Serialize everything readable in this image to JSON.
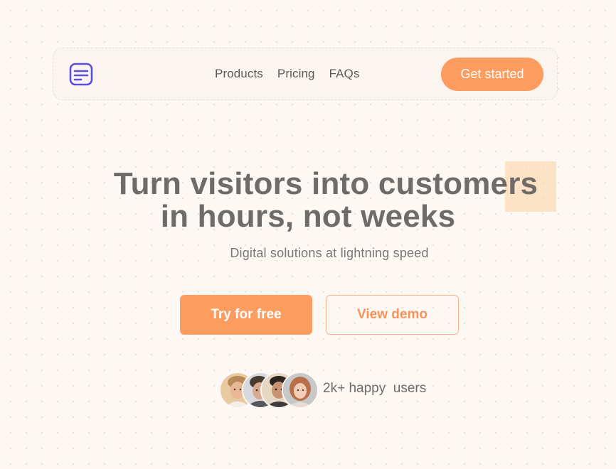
{
  "brand": {
    "logo_icon": "message-lines-icon",
    "accent_color": "#5b4fe0"
  },
  "nav": {
    "links": [
      "Products",
      "Pricing",
      "FAQs"
    ],
    "cta_label": "Get started"
  },
  "hero": {
    "title_line1": "Turn visitors into customers",
    "title_line2": "in hours, not weeks",
    "subtitle": "Digital solutions at lightning speed",
    "primary_cta": "Try for free",
    "secondary_cta": "View demo"
  },
  "social_proof": {
    "text": "2k+ happy  users",
    "avatars": [
      "user-avatar-1",
      "user-avatar-2",
      "user-avatar-3",
      "user-avatar-4"
    ]
  },
  "colors": {
    "primary": "#fd9c5f",
    "background": "#fdf8f4",
    "text": "#6e6b69"
  }
}
